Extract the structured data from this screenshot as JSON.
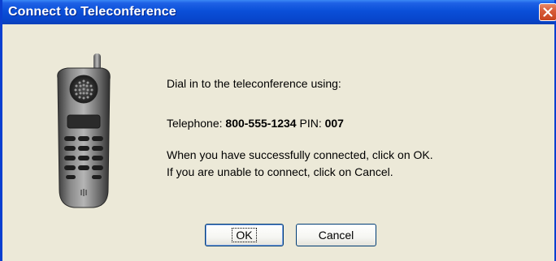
{
  "window": {
    "title": "Connect to Teleconference",
    "close_icon": "close-x-icon"
  },
  "illustration": {
    "icon": "mobile-phone-icon"
  },
  "message": {
    "intro": "Dial in to the teleconference using:",
    "telephone_label": "Telephone:",
    "telephone_number": "800-555-1234",
    "pin_label": "PIN:",
    "pin_value": "007",
    "instruction_ok": "When you have successfully connected, click on OK.",
    "instruction_cancel": "If you are unable to connect, click on Cancel."
  },
  "buttons": {
    "ok_label": "OK",
    "cancel_label": "Cancel"
  },
  "colors": {
    "titlebar": "#0a4fd8",
    "dialog_background": "#ece9d8",
    "close_button": "#d85c3a"
  }
}
